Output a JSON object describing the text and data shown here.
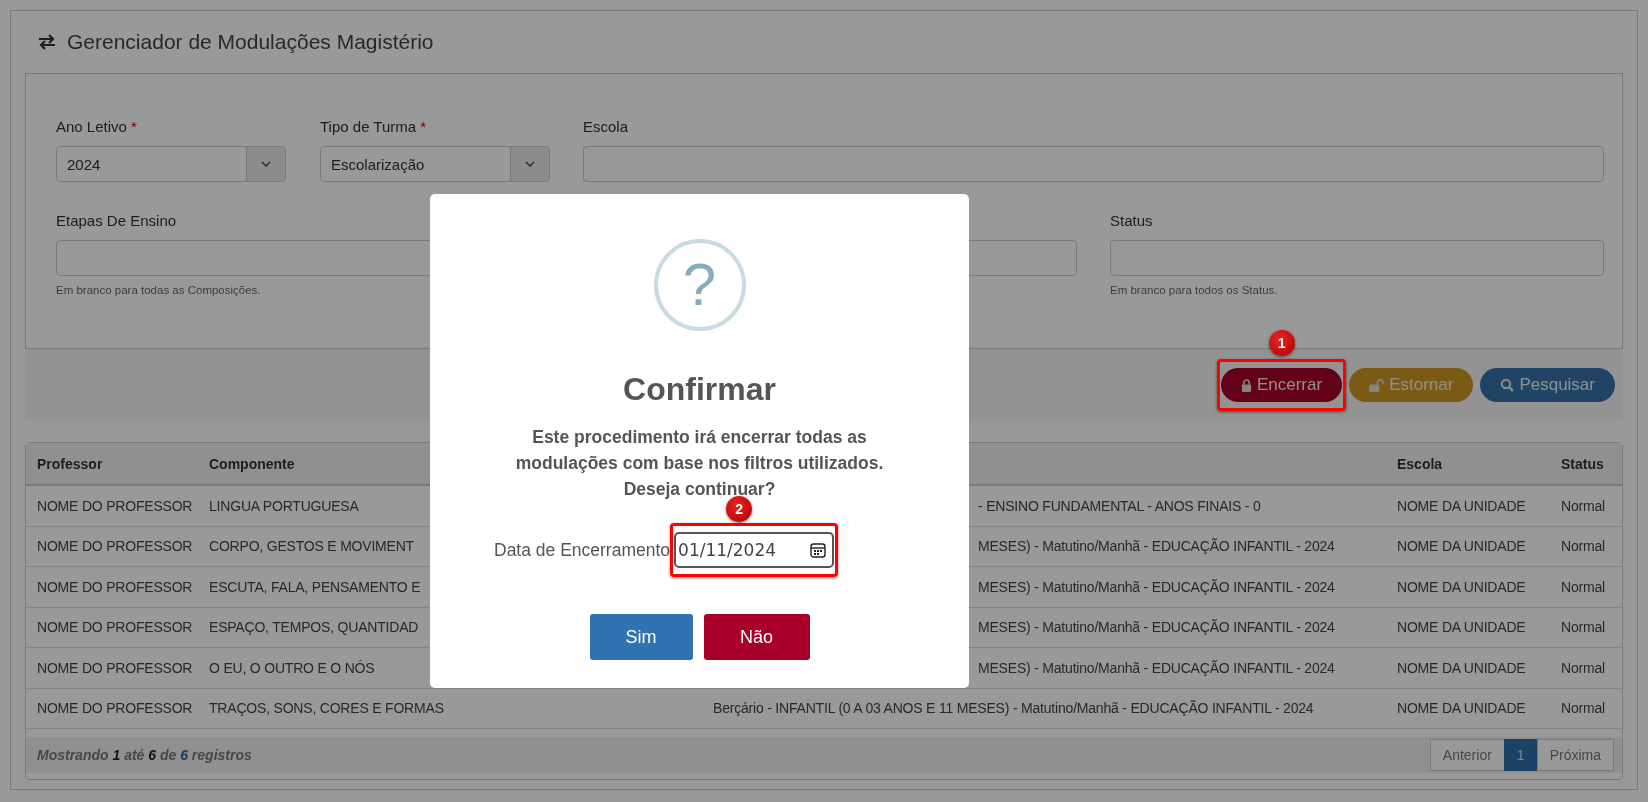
{
  "page": {
    "title": "Gerenciador de Modulações Magistério"
  },
  "filters": {
    "row_1": [
      {
        "label": "Ano Letivo",
        "required_mark": "*",
        "kind": "select",
        "value": "2024"
      },
      {
        "label": "Tipo de Turma",
        "required_mark": "*",
        "kind": "select",
        "value": "Escolarização"
      },
      {
        "label": "Escola",
        "kind": "text"
      }
    ],
    "row_2": [
      {
        "label": "Etapas De Ensino",
        "kind": "text",
        "hint": "Em branco para todas as Composições."
      },
      {
        "kind": "text"
      },
      {
        "label": "Status",
        "kind": "text",
        "hint": "Em branco para todos os Status."
      }
    ]
  },
  "actions": [
    {
      "label": "Encerrar",
      "kind": "danger",
      "annotation": "1"
    },
    {
      "label": "Estornar",
      "kind": "warning"
    },
    {
      "label": "Pesquisar",
      "kind": "primary"
    }
  ],
  "table": {
    "columns": {
      "professor": "Professor",
      "componente": "Componente",
      "escola": "Escola",
      "status": "Status"
    },
    "rows": [
      {
        "professor": "NOME DO PROFESSOR",
        "componente": "LINGUA PORTUGUESA",
        "column_3": "- ENSINO FUNDAMENTAL - ANOS FINAIS - 0",
        "column_3_cut": true,
        "escola": "NOME DA UNIDADE",
        "status": "Normal"
      },
      {
        "professor": "NOME DO PROFESSOR",
        "componente": "CORPO, GESTOS E MOVIMENT",
        "column_3": "MESES) - Matutino/Manhã - EDUCAÇÃO INFANTIL - 2024",
        "column_3_cut": true,
        "escola": "NOME DA UNIDADE",
        "status": "Normal"
      },
      {
        "professor": "NOME DO PROFESSOR",
        "componente": "ESCUTA, FALA, PENSAMENTO E",
        "column_3": "MESES) - Matutino/Manhã - EDUCAÇÃO INFANTIL - 2024",
        "column_3_cut": true,
        "escola": "NOME DA UNIDADE",
        "status": "Normal"
      },
      {
        "professor": "NOME DO PROFESSOR",
        "componente": "ESPAÇO, TEMPOS, QUANTIDAD",
        "column_3": "MESES) - Matutino/Manhã - EDUCAÇÃO INFANTIL - 2024",
        "column_3_cut": true,
        "escola": "NOME DA UNIDADE",
        "status": "Normal"
      },
      {
        "professor": "NOME DO PROFESSOR",
        "componente": "O EU, O OUTRO E O NÓS",
        "column_3": "MESES) - Matutino/Manhã - EDUCAÇÃO INFANTIL - 2024",
        "column_3_cut": true,
        "escola": "NOME DA UNIDADE",
        "status": "Normal"
      },
      {
        "professor": "NOME DO PROFESSOR",
        "componente": "TRAÇOS, SONS, CORES E FORMAS",
        "column_3": "Berçário - INFANTIL (0 A 03 ANOS E 11 MESES) - Matutino/Manhã - EDUCAÇÃO INFANTIL - 2024",
        "column_3_cut": false,
        "escola": "NOME DA UNIDADE",
        "status": "Normal"
      }
    ],
    "summary": [
      {
        "text": "Mostrando ",
        "kind": "plain"
      },
      {
        "text": "1",
        "kind": "number"
      },
      {
        "text": " até ",
        "kind": "plain"
      },
      {
        "text": "6",
        "kind": "number"
      },
      {
        "text": " de ",
        "kind": "plain"
      },
      {
        "text": "6",
        "kind": "total"
      },
      {
        "text": " registros",
        "kind": "plain"
      }
    ],
    "pagination": [
      {
        "label": "Anterior",
        "selected": false
      },
      {
        "label": "1",
        "selected": true
      },
      {
        "label": "Próxima",
        "selected": false
      }
    ]
  },
  "dialog": {
    "icon": "?",
    "title": "Confirmar",
    "message_lines": [
      "Este procedimento irá encerrar todas as",
      "modulações com base nos filtros utilizados.",
      "Deseja continuar?"
    ],
    "date_label": "Data de Encerramento",
    "date_value": "01/11/2024",
    "annotation": "2",
    "buttons": [
      {
        "label": "Sim",
        "kind": "confirm"
      },
      {
        "label": "Não",
        "kind": "cancel"
      }
    ]
  }
}
